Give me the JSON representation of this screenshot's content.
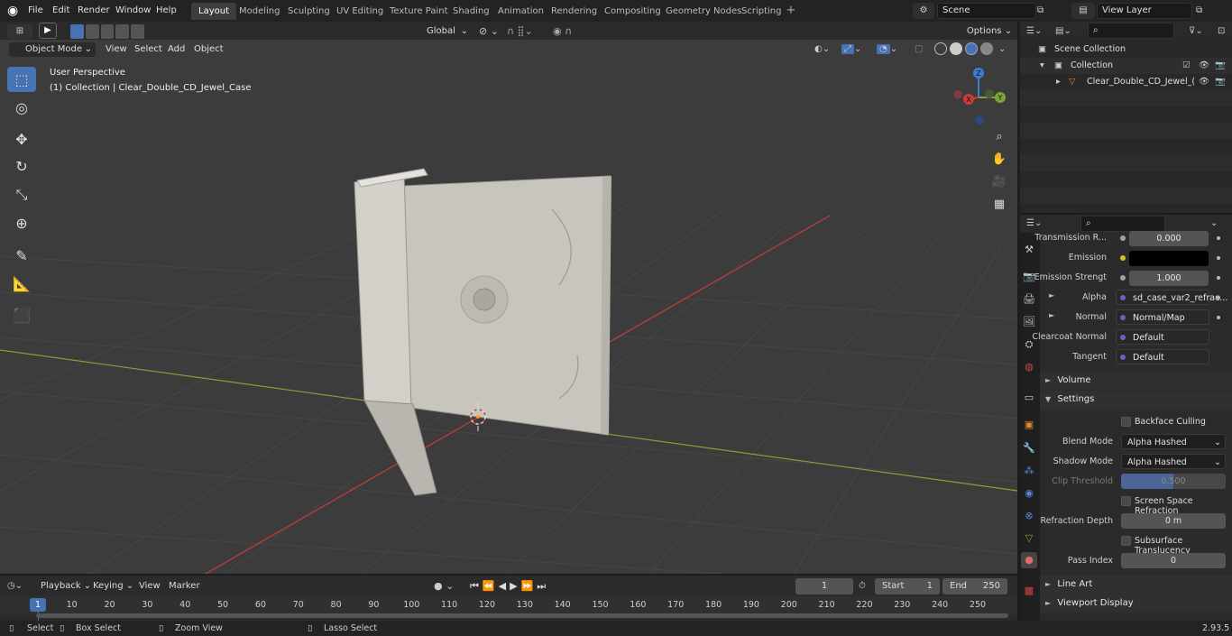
{
  "menus": [
    "File",
    "Edit",
    "Render",
    "Window",
    "Help"
  ],
  "workspaces": [
    {
      "label": "Layout",
      "active": true
    },
    {
      "label": "Modeling"
    },
    {
      "label": "Sculpting"
    },
    {
      "label": "UV Editing"
    },
    {
      "label": "Texture Paint"
    },
    {
      "label": "Shading"
    },
    {
      "label": "Animation"
    },
    {
      "label": "Rendering"
    },
    {
      "label": "Compositing"
    },
    {
      "label": "Geometry Nodes"
    },
    {
      "label": "Scripting"
    }
  ],
  "scene": "Scene",
  "view_layer": "View Layer",
  "viewport_header": {
    "mode": "Object Mode",
    "menu": [
      "View",
      "Select",
      "Add",
      "Object"
    ],
    "transform": "Global",
    "options": "Options"
  },
  "viewport": {
    "perspective": "User Perspective",
    "collection_info": "(1) Collection | Clear_Double_CD_Jewel_Case",
    "gizmo": {
      "x": "X",
      "y": "Y",
      "z": "Z"
    }
  },
  "outliner": {
    "rows": [
      {
        "label": "Scene Collection"
      },
      {
        "label": "Collection"
      },
      {
        "label": "Clear_Double_CD_Jewel_("
      }
    ]
  },
  "properties": {
    "rows": [
      {
        "label": "Transmission R...",
        "value": "0.000",
        "socket": "#c7c729"
      },
      {
        "label": "Emission",
        "value": "",
        "socket": "#c7c729"
      },
      {
        "label": "Emission Strengt",
        "value": "1.000",
        "socket": "#a1a1a1"
      },
      {
        "label": "Alpha",
        "value": "sd_case_var2_refrac...",
        "socket": "#6363c7"
      },
      {
        "label": "Normal",
        "value": "Normal/Map",
        "socket": "#6363c7"
      },
      {
        "label": "Clearcoat Normal",
        "value": "Default",
        "socket": "#6363c7"
      },
      {
        "label": "Tangent",
        "value": "Default",
        "socket": "#6363c7"
      }
    ],
    "sections": {
      "volume": "Volume",
      "settings": "Settings",
      "line_art": "Line Art",
      "viewport_display": "Viewport Display"
    },
    "settings": {
      "backface_culling": "Backface Culling",
      "blend_mode_label": "Blend Mode",
      "blend_mode": "Alpha Hashed",
      "shadow_mode_label": "Shadow Mode",
      "shadow_mode": "Alpha Hashed",
      "clip_threshold_label": "Clip Threshold",
      "clip_threshold": "0.500",
      "ssr": "Screen Space Refraction",
      "refraction_depth_label": "Refraction Depth",
      "refraction_depth": "0 m",
      "subsurface": "Subsurface Translucency",
      "pass_index_label": "Pass Index",
      "pass_index": "0"
    }
  },
  "timeline": {
    "menu": [
      "Playback",
      "Keying",
      "View",
      "Marker"
    ],
    "current_frame": "1",
    "start_label": "Start",
    "start": "1",
    "end_label": "End",
    "end": "250",
    "ticks": [
      "1",
      "10",
      "20",
      "30",
      "40",
      "50",
      "60",
      "70",
      "80",
      "90",
      "100",
      "110",
      "120",
      "130",
      "140",
      "150",
      "160",
      "170",
      "180",
      "190",
      "200",
      "210",
      "220",
      "230",
      "240",
      "250"
    ]
  },
  "status": {
    "select": "Select",
    "box_select": "Box Select",
    "zoom_view": "Zoom View",
    "lasso_select": "Lasso Select",
    "version": "2.93.5"
  },
  "colors": {
    "accent": "#4772b3",
    "x_axis": "#c83c3c",
    "y_axis": "#7ea539",
    "z_axis": "#3c7bd6"
  }
}
